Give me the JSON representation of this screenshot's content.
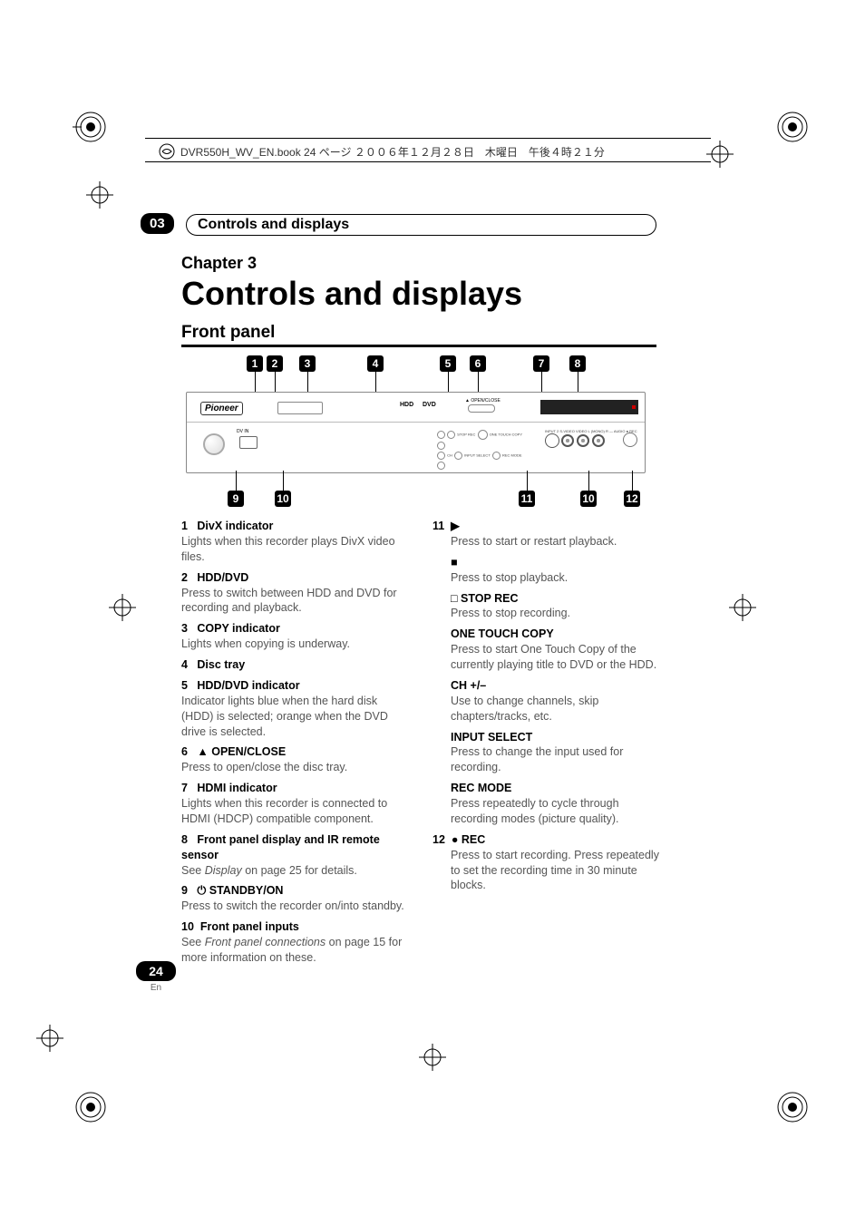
{
  "header": {
    "file_info": "DVR550H_WV_EN.book 24 ページ ２００６年１２月２８日　木曜日　午後４時２１分"
  },
  "chapter_badge": "03",
  "chapter_bar_title": "Controls and displays",
  "chapter_label": "Chapter 3",
  "chapter_title": "Controls and displays",
  "section_title": "Front panel",
  "diagram": {
    "brand": "Pioneer",
    "hdd_label": "HDD",
    "dvd_label": "DVD",
    "open_close_label": "▲ OPEN/CLOSE",
    "dvin_label": "DV IN",
    "input2_label": "INPUT 2",
    "svideo_label": "S-VIDEO",
    "video_label": "VIDEO",
    "audio_lr_label": "L (MONO) R — AUDIO",
    "rec_label": "● REC",
    "stop_rec_label": "STOP REC",
    "one_touch_copy_label": "ONE TOUCH COPY",
    "input_select_label": "INPUT SELECT",
    "rec_mode_label": "REC MODE",
    "badges_top": [
      "1",
      "2",
      "3",
      "4",
      "5",
      "6",
      "7",
      "8"
    ],
    "badges_bottom": [
      "9",
      "10",
      "11",
      "10",
      "12"
    ]
  },
  "left_col": [
    {
      "num": "1",
      "title": "DivX indicator",
      "body": "Lights when this recorder plays DivX video files."
    },
    {
      "num": "2",
      "title": "HDD/DVD",
      "body": "Press to switch between HDD and DVD for recording and playback."
    },
    {
      "num": "3",
      "title": "COPY indicator",
      "body": "Lights when copying is underway."
    },
    {
      "num": "4",
      "title": "Disc tray",
      "body": ""
    },
    {
      "num": "5",
      "title": "HDD/DVD indicator",
      "body": "Indicator lights blue when the hard disk (HDD) is selected; orange when the DVD drive is selected."
    },
    {
      "num": "6",
      "title_pre": "▲",
      "title": "OPEN/CLOSE",
      "body": "Press to open/close the disc tray."
    },
    {
      "num": "7",
      "title": "HDMI indicator",
      "body": "Lights when this recorder is connected to HDMI (HDCP) compatible component."
    },
    {
      "num": "8",
      "title": "Front panel display and IR remote sensor",
      "body_pre": "See ",
      "body_ref": "Display",
      "body_post": " on page 25 for details."
    },
    {
      "num": "9",
      "title_pre": "⏻",
      "title": "STANDBY/ON",
      "body": "Press to switch the recorder on/into standby."
    },
    {
      "num": "10",
      "title": "Front panel inputs",
      "body_pre": "See ",
      "body_ref": "Front panel connections",
      "body_post": " on page 15 for more information on these."
    }
  ],
  "right_col": {
    "item11": {
      "num": "11",
      "play_sym": "▶",
      "play_body": "Press to start or restart playback.",
      "stop_sym": "■",
      "stop_body": "Press to stop playback.",
      "stop_rec_sym": "□",
      "stop_rec_title": "STOP REC",
      "stop_rec_body": "Press to stop recording.",
      "otc_title": "ONE TOUCH COPY",
      "otc_body": "Press to start One Touch Copy of the currently playing title to DVD or the HDD.",
      "ch_title": "CH +/–",
      "ch_body": "Use to change channels, skip chapters/tracks, etc.",
      "input_title": "INPUT SELECT",
      "input_body": "Press to change the input used for recording.",
      "recmode_title": "REC MODE",
      "recmode_body": "Press repeatedly to cycle through recording modes (picture quality)."
    },
    "item12": {
      "num": "12",
      "sym": "●",
      "title": "REC",
      "body": "Press to start recording. Press repeatedly to set the recording time in 30 minute blocks."
    }
  },
  "page_number": "24",
  "page_lang": "En"
}
